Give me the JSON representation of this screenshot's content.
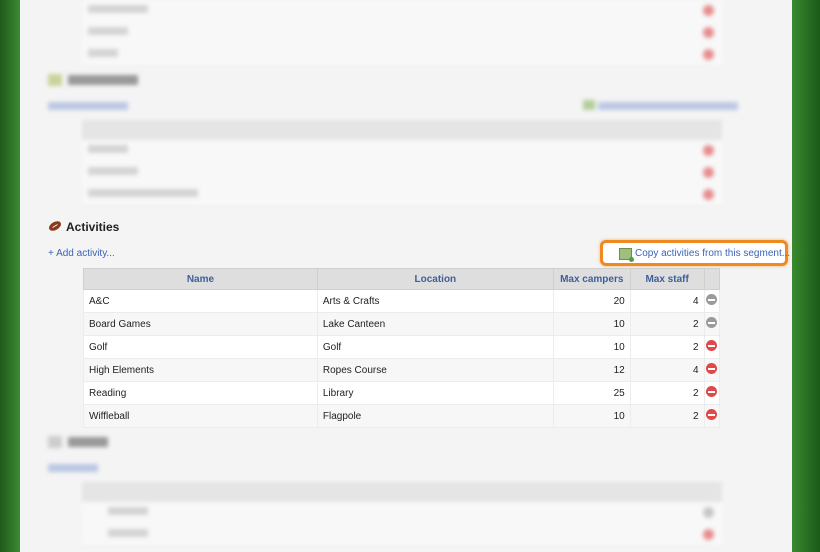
{
  "activities": {
    "title": "Activities",
    "add_label": "+ Add activity...",
    "copy_label": "Copy activities from this segment...",
    "columns": [
      "Name",
      "Location",
      "Max campers",
      "Max staff"
    ],
    "rows": [
      {
        "name": "A&C",
        "location": "Arts & Crafts",
        "max_campers": "20",
        "max_staff": "4",
        "remove_status": "disabled"
      },
      {
        "name": "Board Games",
        "location": "Lake Canteen",
        "max_campers": "10",
        "max_staff": "2",
        "remove_status": "disabled"
      },
      {
        "name": "Golf",
        "location": "Golf",
        "max_campers": "10",
        "max_staff": "2",
        "remove_status": "active"
      },
      {
        "name": "High Elements",
        "location": "Ropes Course",
        "max_campers": "12",
        "max_staff": "4",
        "remove_status": "active"
      },
      {
        "name": "Reading",
        "location": "Library",
        "max_campers": "25",
        "max_staff": "2",
        "remove_status": "active"
      },
      {
        "name": "Wiffleball",
        "location": "Flagpole",
        "max_campers": "10",
        "max_staff": "2",
        "remove_status": "active"
      }
    ]
  },
  "icons": {
    "activities": "football-icon",
    "copy": "copy-segment-icon",
    "remove": "remove-circle-icon"
  },
  "colors": {
    "highlight": "#ee8a20",
    "link": "#3b63b8",
    "remove_active": "#e0484a",
    "remove_disabled": "#9a9a9a",
    "background": "#2f7a2a"
  }
}
